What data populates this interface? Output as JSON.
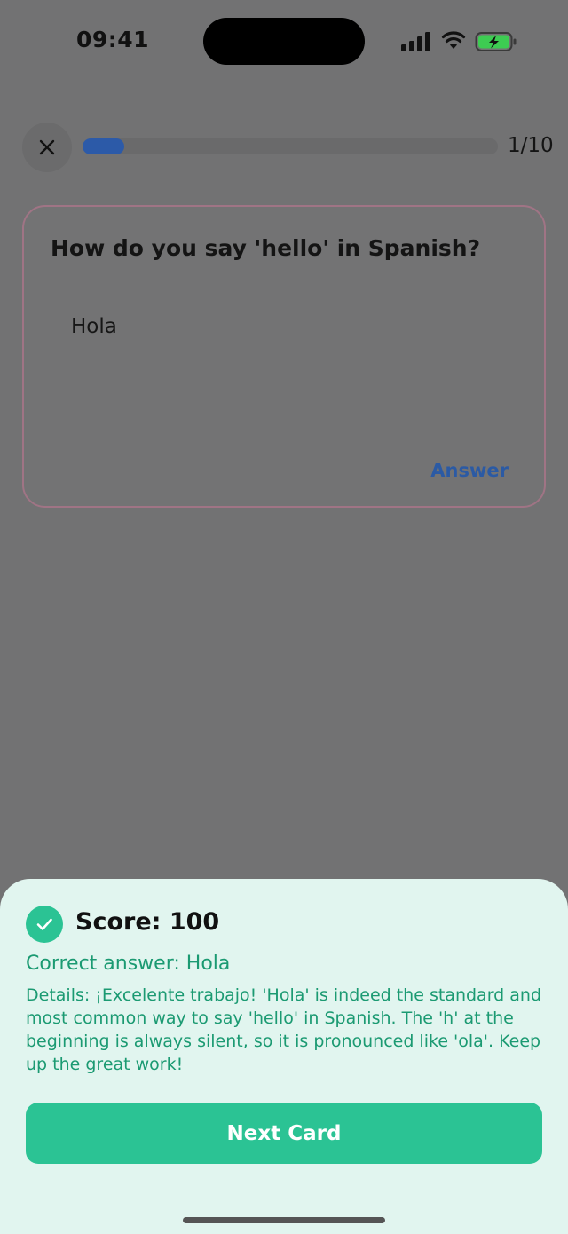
{
  "status_bar": {
    "time": "09:41"
  },
  "header": {
    "progress": {
      "current": 1,
      "total": 10,
      "label": "1/10",
      "fraction": 0.1
    }
  },
  "card": {
    "question": "How do you say 'hello' in Spanish?",
    "user_answer": "Hola",
    "answer_link": "Answer"
  },
  "result": {
    "score": "Score: 100",
    "correct_answer": "Correct answer: Hola",
    "details": "Details: ¡Excelente trabajo! 'Hola' is indeed the standard and most common way to say 'hello' in Spanish. The 'h' at the beginning is always silent, so it is pronounced like 'ola'. Keep up the great work!",
    "next_button": "Next Card"
  },
  "icons": {
    "close": "close-icon",
    "check": "check-icon",
    "signal": "cellular-signal-icon",
    "wifi": "wifi-icon",
    "battery": "battery-charging-icon"
  },
  "colors": {
    "overlay_bg": "#727273",
    "accent_blue": "#2c5aa8",
    "success_green": "#2bc394",
    "success_text": "#1b9a72",
    "sheet_bg": "#e1f5ef",
    "card_border": "#a07485"
  }
}
